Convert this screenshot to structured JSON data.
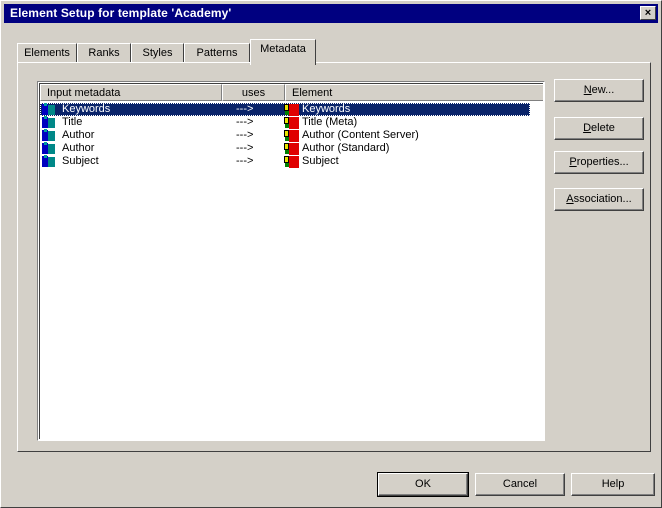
{
  "window": {
    "title": "Element Setup for template 'Academy'",
    "close_glyph": "×"
  },
  "tabs": [
    {
      "label": "Elements"
    },
    {
      "label": "Ranks"
    },
    {
      "label": "Styles"
    },
    {
      "label": "Patterns"
    },
    {
      "label": "Metadata",
      "active": true
    }
  ],
  "list": {
    "columns": [
      "Input metadata",
      "uses",
      "Element"
    ],
    "rows": [
      {
        "input": "Keywords",
        "uses": "--->",
        "element": "Keywords",
        "selected": true
      },
      {
        "input": "Title",
        "uses": "--->",
        "element": "Title (Meta)"
      },
      {
        "input": "Author",
        "uses": "--->",
        "element": "Author (Content Server)"
      },
      {
        "input": "Author",
        "uses": "--->",
        "element": "Author (Standard)"
      },
      {
        "input": "Subject",
        "uses": "--->",
        "element": "Subject"
      }
    ]
  },
  "side_buttons": {
    "new": {
      "accel": "N",
      "rest": "ew..."
    },
    "delete": {
      "accel": "D",
      "rest": "elete"
    },
    "properties": {
      "accel": "P",
      "rest": "roperties..."
    },
    "association": {
      "accel": "A",
      "rest": "ssociation..."
    }
  },
  "footer_buttons": {
    "ok": "OK",
    "cancel": "Cancel",
    "help": "Help"
  },
  "icons": {
    "input_metadata": "metadata-input-icon",
    "element": "element-icon"
  }
}
